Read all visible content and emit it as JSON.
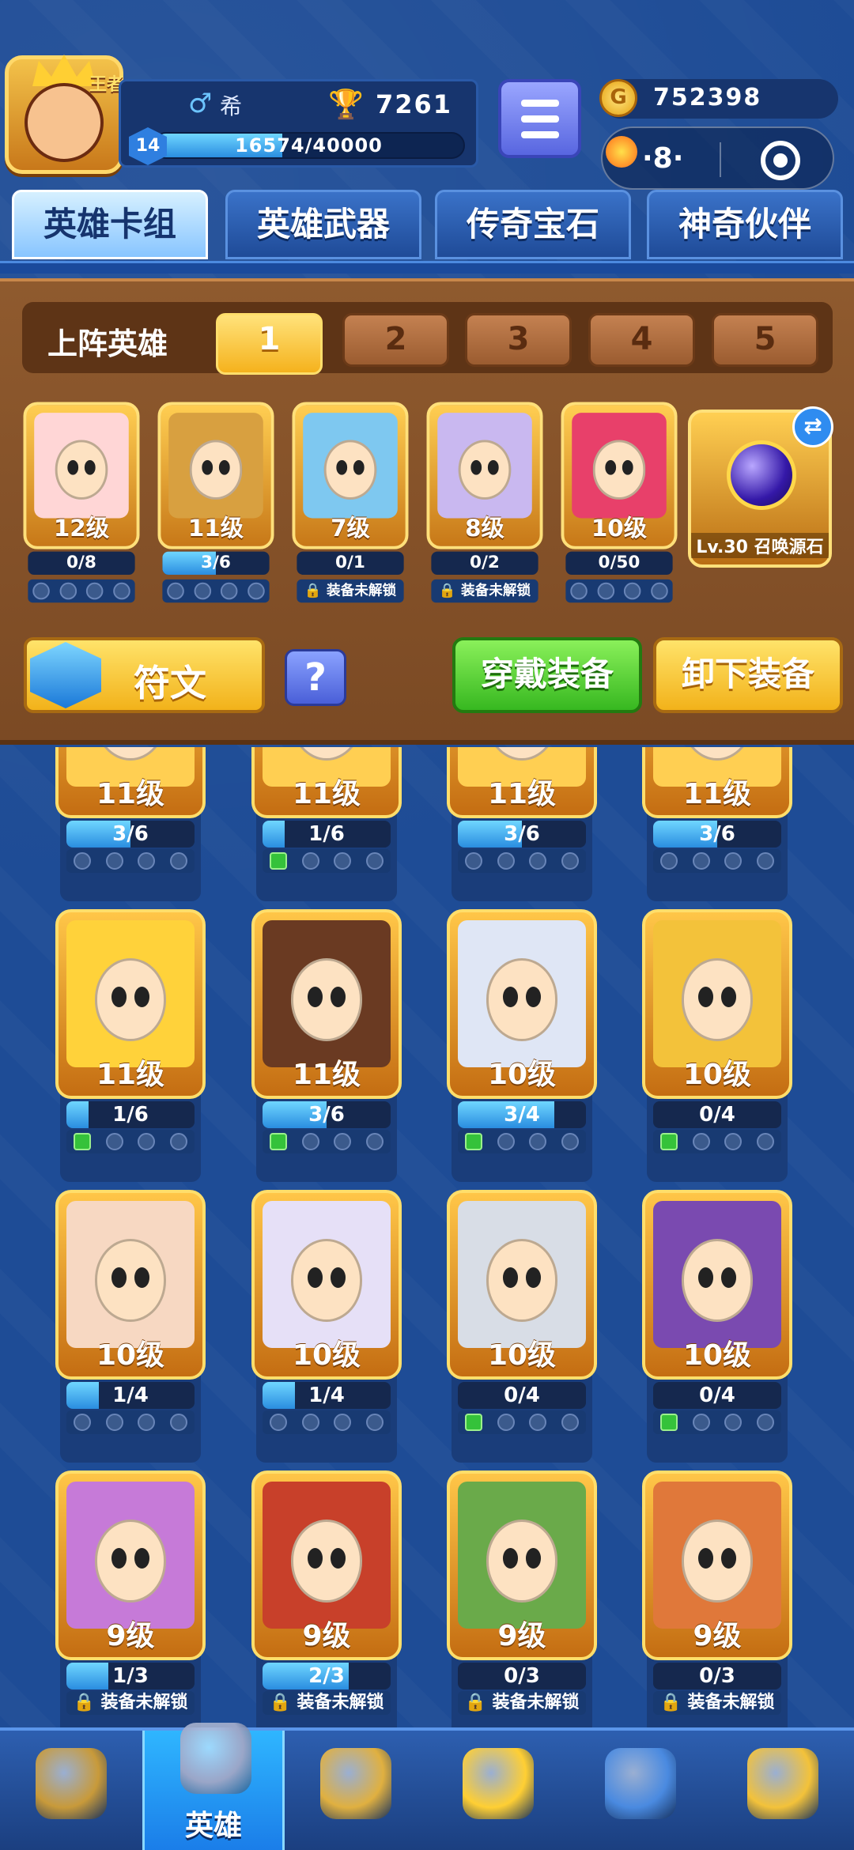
{
  "player": {
    "name": "希",
    "level": "14",
    "trophies": "7261",
    "xp_text": "16574/40000",
    "xp_fraction": 0.414,
    "avatar_tag": "王者"
  },
  "currency": {
    "coins": "752398",
    "coin_symbol": "G",
    "capsule_dots": "·8·"
  },
  "tabs": [
    "英雄卡组",
    "英雄武器",
    "传奇宝石",
    "神奇伙伴"
  ],
  "deck": {
    "label": "上阵英雄",
    "slots": [
      "1",
      "2",
      "3",
      "4",
      "5"
    ],
    "heroes": [
      {
        "level": "12级",
        "progress": "0/8",
        "fill": 0.0,
        "equip": "slots",
        "color": "#ffd6d6"
      },
      {
        "level": "11级",
        "progress": "3/6",
        "fill": 0.5,
        "equip": "slots",
        "color": "#d8a040"
      },
      {
        "level": "7级",
        "progress": "0/1",
        "fill": 0.0,
        "equip": "locked",
        "color": "#7ec8f0"
      },
      {
        "level": "8级",
        "progress": "0/2",
        "fill": 0.0,
        "equip": "locked",
        "color": "#c9b8f0"
      },
      {
        "level": "10级",
        "progress": "0/50",
        "fill": 0.0,
        "equip": "slots",
        "color": "#e8406a"
      }
    ],
    "stone_label": "Lv.30 召唤源石",
    "swap_symbol": "⇄",
    "rune_label": "符文",
    "help_label": "?",
    "equip_label": "穿戴装备",
    "unequip_label": "卸下装备",
    "locked_text": "装备未解锁"
  },
  "grid": [
    {
      "level": "11级",
      "progress": "3/6",
      "fill": 0.5,
      "equip": "slots",
      "plus": false,
      "color": "#ffcf52"
    },
    {
      "level": "11级",
      "progress": "1/6",
      "fill": 0.17,
      "equip": "slots",
      "plus": true,
      "color": "#ffcf52"
    },
    {
      "level": "11级",
      "progress": "3/6",
      "fill": 0.5,
      "equip": "slots",
      "plus": false,
      "color": "#ffcf52"
    },
    {
      "level": "11级",
      "progress": "3/6",
      "fill": 0.5,
      "equip": "slots",
      "plus": false,
      "color": "#ffcf52"
    },
    {
      "level": "11级",
      "progress": "1/6",
      "fill": 0.17,
      "equip": "slots",
      "plus": true,
      "color": "#ffd23a"
    },
    {
      "level": "11级",
      "progress": "3/6",
      "fill": 0.5,
      "equip": "slots",
      "plus": true,
      "color": "#6a3a22"
    },
    {
      "level": "10级",
      "progress": "3/4",
      "fill": 0.75,
      "equip": "slots",
      "plus": true,
      "color": "#dfe6f5"
    },
    {
      "level": "10级",
      "progress": "0/4",
      "fill": 0.0,
      "equip": "slots",
      "plus": true,
      "color": "#f3c23a"
    },
    {
      "level": "10级",
      "progress": "1/4",
      "fill": 0.25,
      "equip": "slots",
      "plus": false,
      "color": "#f7d8c2"
    },
    {
      "level": "10级",
      "progress": "1/4",
      "fill": 0.25,
      "equip": "slots",
      "plus": false,
      "color": "#e6e0f7"
    },
    {
      "level": "10级",
      "progress": "0/4",
      "fill": 0.0,
      "equip": "slots",
      "plus": true,
      "color": "#d8dde6"
    },
    {
      "level": "10级",
      "progress": "0/4",
      "fill": 0.0,
      "equip": "slots",
      "plus": true,
      "color": "#7a4ab0"
    },
    {
      "level": "9级",
      "progress": "1/3",
      "fill": 0.33,
      "equip": "locked",
      "plus": false,
      "color": "#c67ad8"
    },
    {
      "level": "9级",
      "progress": "2/3",
      "fill": 0.67,
      "equip": "locked",
      "plus": false,
      "color": "#c8402a"
    },
    {
      "level": "9级",
      "progress": "0/3",
      "fill": 0.0,
      "equip": "locked",
      "plus": false,
      "color": "#6aaa4a"
    },
    {
      "level": "9级",
      "progress": "0/3",
      "fill": 0.0,
      "equip": "locked",
      "plus": false,
      "color": "#e0783a"
    }
  ],
  "nav": [
    {
      "icon": "treasure-chest-icon",
      "label": "",
      "active": false
    },
    {
      "icon": "knight-helmet-icon",
      "label": "英雄",
      "active": true
    },
    {
      "icon": "crossed-swords-icon",
      "label": "",
      "active": false
    },
    {
      "icon": "crown-shield-icon",
      "label": "",
      "active": false
    },
    {
      "icon": "guild-banner-icon",
      "label": "",
      "active": false
    },
    {
      "icon": "compass-icon",
      "label": "",
      "active": false
    }
  ],
  "colors": {
    "accent": "#f5b21d",
    "green": "#37b820",
    "panel": "#17356e",
    "brown": "#7b4a24"
  }
}
